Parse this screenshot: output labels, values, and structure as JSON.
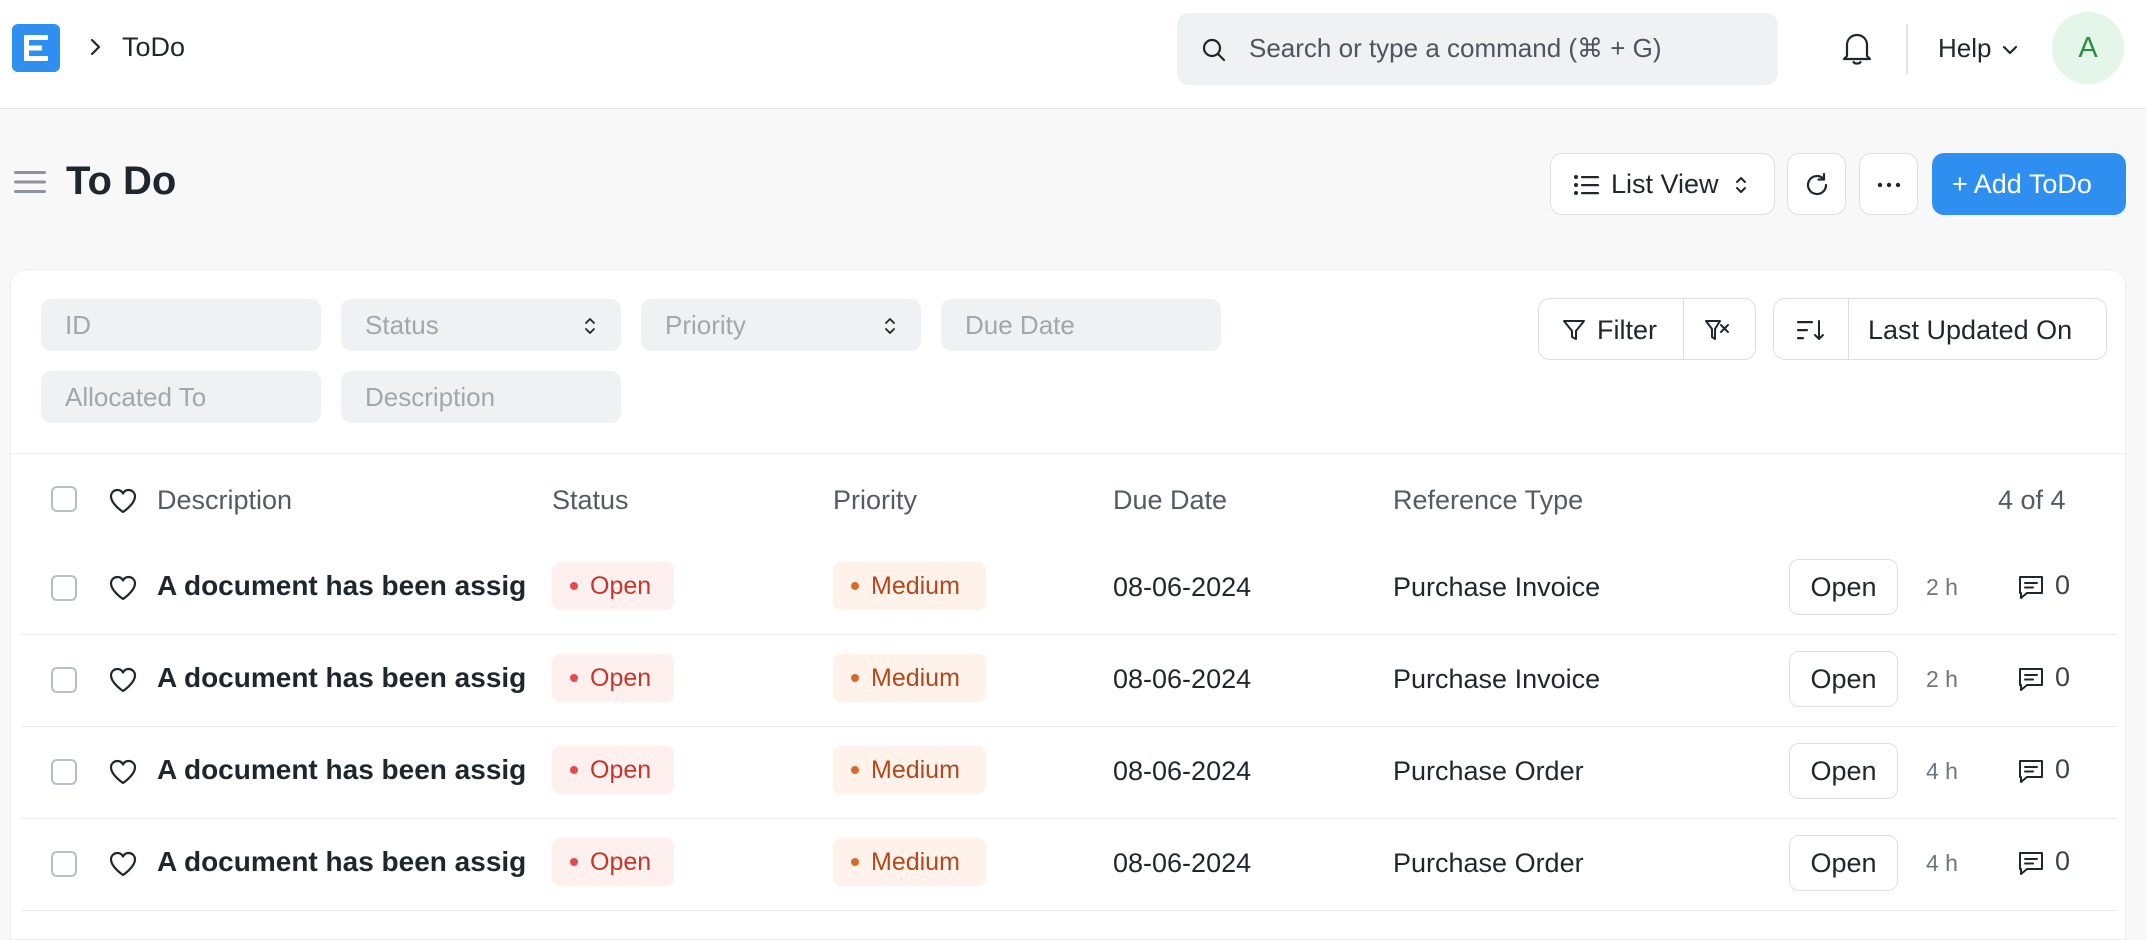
{
  "navbar": {
    "logo_letter": "E",
    "breadcrumb": "ToDo",
    "search_placeholder": "Search or type a command (⌘ + G)",
    "help_label": "Help",
    "avatar_initial": "A",
    "icons": [
      "chevron-right-icon",
      "search-icon",
      "bell-icon",
      "chevron-down-icon"
    ]
  },
  "page": {
    "title": "To Do",
    "list_view_label": "List View",
    "add_button_label": "+ Add ToDo",
    "accent_color": "#2f8ff0"
  },
  "filters": {
    "id_placeholder": "ID",
    "status_placeholder": "Status",
    "priority_placeholder": "Priority",
    "due_date_placeholder": "Due Date",
    "allocated_to_placeholder": "Allocated To",
    "description_placeholder": "Description",
    "filter_label": "Filter",
    "sort_label": "Last Updated On"
  },
  "table": {
    "columns": [
      "Description",
      "Status",
      "Priority",
      "Due Date",
      "Reference Type"
    ],
    "count": "4 of 4",
    "rows": [
      {
        "description": "A document has been assigned to you",
        "status": "Open",
        "priority": "Medium",
        "due_date": "08-06-2024",
        "reference_type": "Purchase Invoice",
        "action": "Open",
        "time": "2 h",
        "comments": "0"
      },
      {
        "description": "A document has been assigned to you",
        "status": "Open",
        "priority": "Medium",
        "due_date": "08-06-2024",
        "reference_type": "Purchase Invoice",
        "action": "Open",
        "time": "2 h",
        "comments": "0"
      },
      {
        "description": "A document has been assigned to you",
        "status": "Open",
        "priority": "Medium",
        "due_date": "08-06-2024",
        "reference_type": "Purchase Order",
        "action": "Open",
        "time": "4 h",
        "comments": "0"
      },
      {
        "description": "A document has been assigned to you",
        "status": "Open",
        "priority": "Medium",
        "due_date": "08-06-2024",
        "reference_type": "Purchase Order",
        "action": "Open",
        "time": "4 h",
        "comments": "0"
      }
    ]
  }
}
